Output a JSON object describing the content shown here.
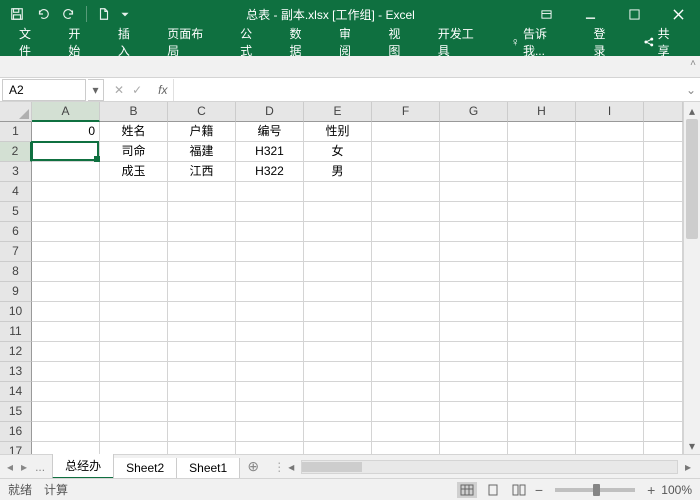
{
  "title": "总表 - 副本.xlsx [工作组] - Excel",
  "tabs": {
    "file": "文件",
    "home": "开始",
    "insert": "插入",
    "layout": "页面布局",
    "formula": "公式",
    "data": "数据",
    "review": "审阅",
    "view": "视图",
    "dev": "开发工具",
    "tell": "告诉我...",
    "login": "登录",
    "share": "共享"
  },
  "namebox": "A2",
  "fx_label": "fx",
  "columns": [
    "A",
    "B",
    "C",
    "D",
    "E",
    "F",
    "G",
    "H",
    "I"
  ],
  "rows": [
    "1",
    "2",
    "3",
    "4",
    "5",
    "6",
    "7",
    "8",
    "9",
    "10",
    "11",
    "12",
    "13",
    "14",
    "15",
    "16",
    "17"
  ],
  "chart_data": {
    "type": "table",
    "selected": "A2",
    "cells": {
      "A1": "0",
      "B1": "姓名",
      "C1": "户籍",
      "D1": "编号",
      "E1": "性别",
      "B2": "司命",
      "C2": "福建",
      "D2": "H321",
      "E2": "女",
      "B3": "成玉",
      "C3": "江西",
      "D3": "H322",
      "E3": "男"
    }
  },
  "sheets": {
    "nav": "...",
    "active": "总经办",
    "s2": "Sheet2",
    "s3": "Sheet1"
  },
  "status": {
    "ready": "就绪",
    "calc": "计算",
    "zoom": "100%"
  }
}
